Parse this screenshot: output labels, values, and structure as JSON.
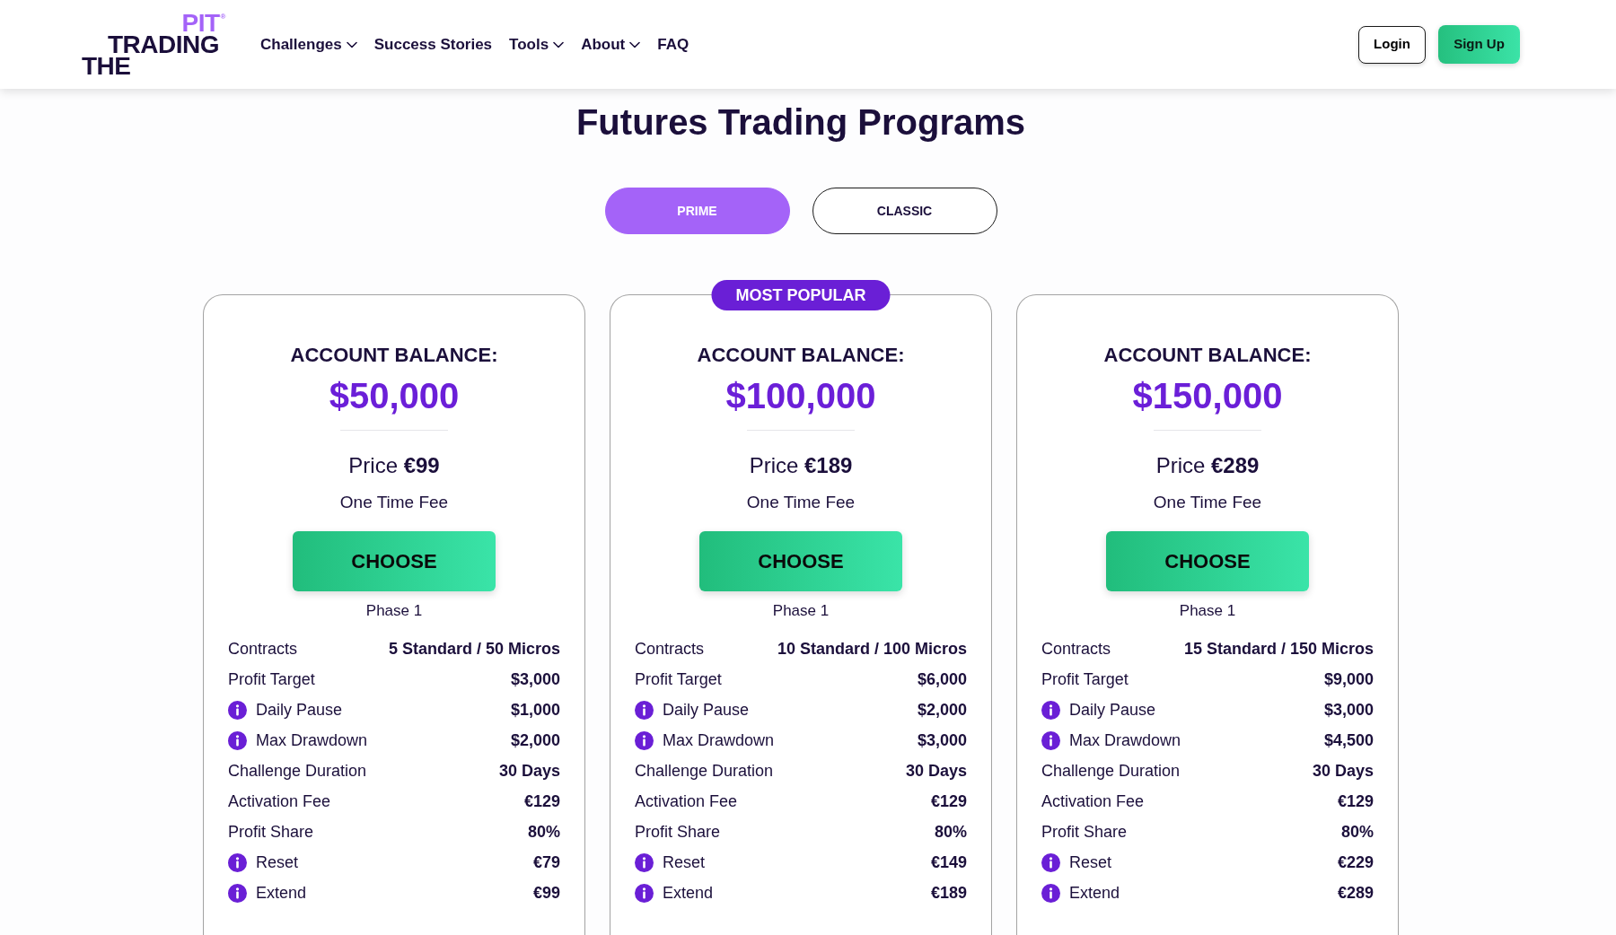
{
  "header": {
    "logo": {
      "top": "PIT",
      "mark": "®",
      "middle": "TRADING",
      "bottom": "THE"
    },
    "nav": [
      {
        "label": "Challenges",
        "dropdown": true
      },
      {
        "label": "Success Stories",
        "dropdown": false
      },
      {
        "label": "Tools",
        "dropdown": true
      },
      {
        "label": "About",
        "dropdown": true
      },
      {
        "label": "FAQ",
        "dropdown": false
      }
    ],
    "buttons": [
      {
        "label": "Login",
        "kind": "outline"
      },
      {
        "label": "Sign Up",
        "kind": "primary"
      }
    ]
  },
  "title": "Futures Trading Programs",
  "tabs": [
    {
      "label": "PRIME",
      "selected": true
    },
    {
      "label": "CLASSIC",
      "selected": false
    }
  ],
  "plans": [
    {
      "balance_label": "ACCOUNT BALANCE:",
      "balance": "$50,000",
      "price": "Price **€99**",
      "fee_note": "One Time Fee",
      "button": "CHOOSE",
      "phase": "Phase 1",
      "rows": [
        {
          "label": "Contracts",
          "value": "5 Standard / 50 Micros",
          "info": false
        },
        {
          "label": "Profit Target",
          "value": "$3,000",
          "info": false
        },
        {
          "label": "Daily Pause",
          "value": "$1,000",
          "info": true
        },
        {
          "label": "Max Drawdown",
          "value": "$2,000",
          "info": true
        },
        {
          "label": "Challenge Duration",
          "value": "30 Days",
          "info": false
        },
        {
          "label": "Activation Fee",
          "value": "€129",
          "info": false
        },
        {
          "label": "Profit Share",
          "value": "80%",
          "info": false
        },
        {
          "label": "Reset",
          "value": "€79",
          "info": true
        },
        {
          "label": "Extend",
          "value": "€99",
          "info": true
        }
      ]
    },
    {
      "badge": "MOST POPULAR",
      "balance_label": "ACCOUNT BALANCE:",
      "balance": "$100,000",
      "price": "Price **€189**",
      "fee_note": "One Time Fee",
      "button": "CHOOSE",
      "phase": "Phase 1",
      "rows": [
        {
          "label": "Contracts",
          "value": "10 Standard / 100 Micros",
          "info": false
        },
        {
          "label": "Profit Target",
          "value": "$6,000",
          "info": false
        },
        {
          "label": "Daily Pause",
          "value": "$2,000",
          "info": true
        },
        {
          "label": "Max Drawdown",
          "value": "$3,000",
          "info": true
        },
        {
          "label": "Challenge Duration",
          "value": "30 Days",
          "info": false
        },
        {
          "label": "Activation Fee",
          "value": "€129",
          "info": false
        },
        {
          "label": "Profit Share",
          "value": "80%",
          "info": false
        },
        {
          "label": "Reset",
          "value": "€149",
          "info": true
        },
        {
          "label": "Extend",
          "value": "€189",
          "info": true
        }
      ]
    },
    {
      "balance_label": "ACCOUNT BALANCE:",
      "balance": "$150,000",
      "price": "Price **€289**",
      "fee_note": "One Time Fee",
      "button": "CHOOSE",
      "phase": "Phase 1",
      "rows": [
        {
          "label": "Contracts",
          "value": "15 Standard / 150 Micros",
          "info": false
        },
        {
          "label": "Profit Target",
          "value": "$9,000",
          "info": false
        },
        {
          "label": "Daily Pause",
          "value": "$3,000",
          "info": true
        },
        {
          "label": "Max Drawdown",
          "value": "$4,500",
          "info": true
        },
        {
          "label": "Challenge Duration",
          "value": "30 Days",
          "info": false
        },
        {
          "label": "Activation Fee",
          "value": "€129",
          "info": false
        },
        {
          "label": "Profit Share",
          "value": "80%",
          "info": false
        },
        {
          "label": "Reset",
          "value": "€229",
          "info": true
        },
        {
          "label": "Extend",
          "value": "€289",
          "info": true
        }
      ]
    }
  ]
}
